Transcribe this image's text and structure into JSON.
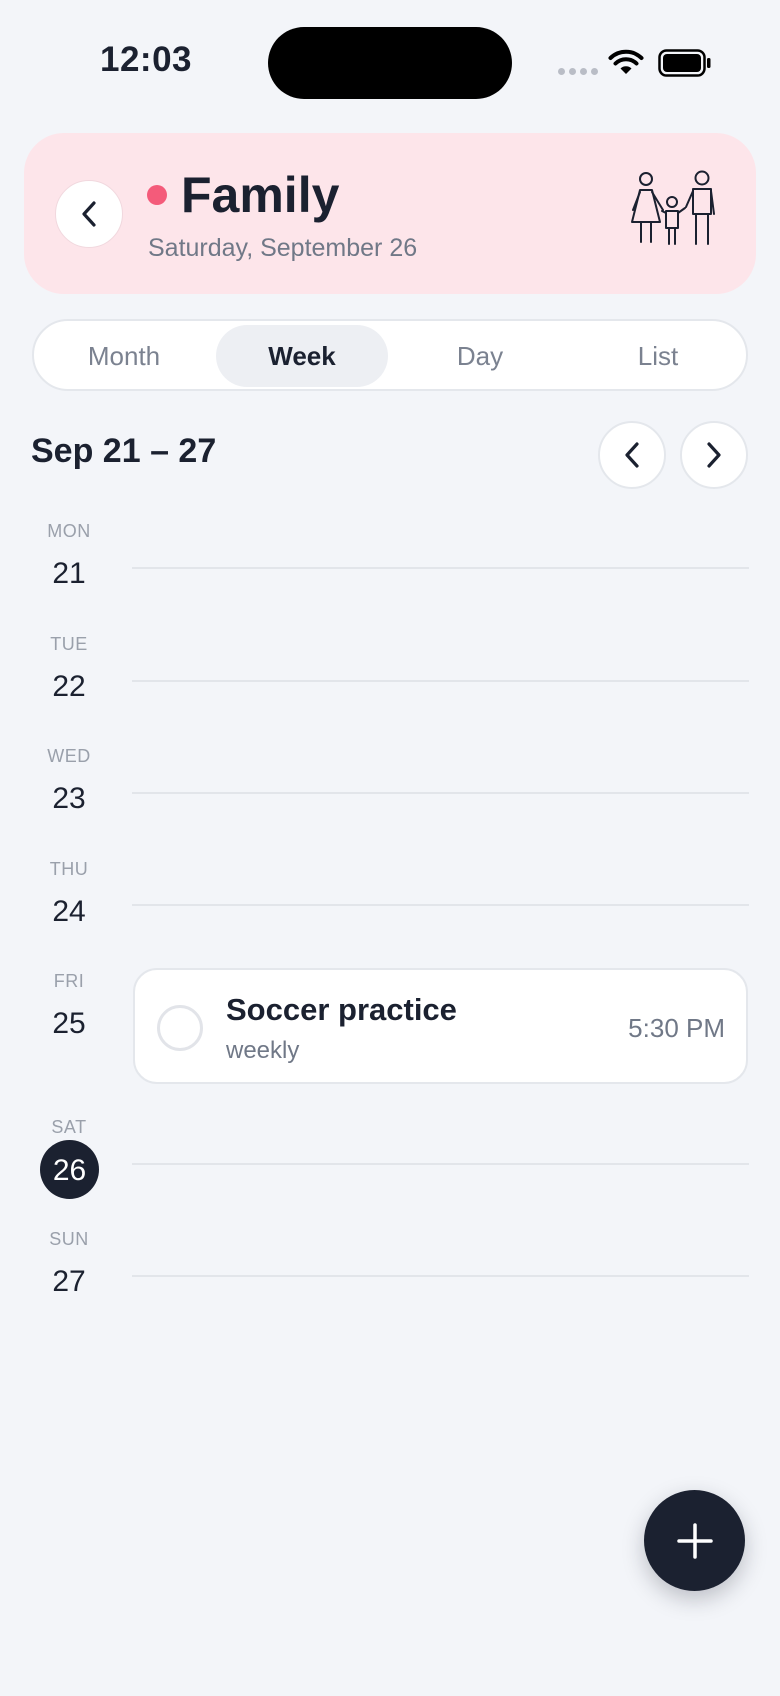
{
  "status_bar": {
    "time": "12:03"
  },
  "header": {
    "title": "Family",
    "subtitle": "Saturday, September 26",
    "accent_color": "#f45b7a",
    "icon": "family-icon"
  },
  "view_tabs": [
    {
      "label": "Month",
      "active": false
    },
    {
      "label": "Week",
      "active": true
    },
    {
      "label": "Day",
      "active": false
    },
    {
      "label": "List",
      "active": false
    }
  ],
  "week": {
    "range": "Sep 21 – 27",
    "days": [
      {
        "abbr": "MON",
        "num": "21"
      },
      {
        "abbr": "TUE",
        "num": "22"
      },
      {
        "abbr": "WED",
        "num": "23"
      },
      {
        "abbr": "THU",
        "num": "24"
      },
      {
        "abbr": "FRI",
        "num": "25"
      },
      {
        "abbr": "SAT",
        "num": "26",
        "today": true
      },
      {
        "abbr": "SUN",
        "num": "27"
      }
    ]
  },
  "events": [
    {
      "day": "FRI",
      "title": "Soccer practice",
      "recurrence": "weekly",
      "time": "5:30 PM",
      "done": false
    }
  ]
}
